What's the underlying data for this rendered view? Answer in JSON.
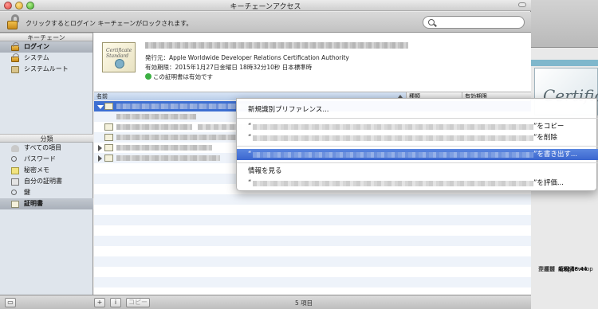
{
  "window": {
    "title": "キーチェーンアクセス"
  },
  "toolbar": {
    "lock_text": "クリックするとログイン キーチェーンがロックされます。",
    "search_placeholder": ""
  },
  "sidebar": {
    "keychain_header": "キーチェーン",
    "keychains": [
      {
        "label": "ログイン",
        "icon": "lock-icon"
      },
      {
        "label": "システム",
        "icon": "lock-icon"
      },
      {
        "label": "システムルート",
        "icon": "folder-icon"
      }
    ],
    "category_header": "分類",
    "categories": [
      {
        "label": "すべての項目",
        "icon": "people-icon"
      },
      {
        "label": "パスワード",
        "icon": "key-icon"
      },
      {
        "label": "秘密メモ",
        "icon": "note-icon"
      },
      {
        "label": "自分の証明書",
        "icon": "id-icon"
      },
      {
        "label": "鍵",
        "icon": "key-icon"
      },
      {
        "label": "証明書",
        "icon": "certificate-icon"
      }
    ]
  },
  "detail": {
    "issuer": "発行元：Apple Worldwide Developer Relations Certification Authority",
    "expiry": "有効期限：2015年1月27日金曜日 18時32分10秒 日本標準時",
    "status": "この証明書は有効です",
    "cert_image_text": "Certificate Standard"
  },
  "list": {
    "columns": [
      "名前",
      "種類",
      "有効期限"
    ]
  },
  "context_menu": {
    "new_pref": "新規識別プリファレンス...",
    "open_quote": "“",
    "copy_suffix": "”をコピー",
    "delete_suffix": "”を削除",
    "export_suffix": "”を書き出す...",
    "get_info": "情報を見る",
    "evaluate_suffix": "”を評価..."
  },
  "bottombar": {
    "add": "+",
    "info": "i",
    "copy": "コピー",
    "status": "5 項目"
  },
  "background_window": {
    "cert_text": "Certific",
    "info_rows": [
      {
        "key": "名前",
        "value": "aps_develop"
      },
      {
        "key": "種類",
        "value": "証明書"
      },
      {
        "key": "サイズ",
        "value": "1 KB"
      },
      {
        "key": "作成日",
        "value": "今日 18:44"
      },
      {
        "key": "変更日",
        "value": "今日 18:44"
      }
    ]
  }
}
